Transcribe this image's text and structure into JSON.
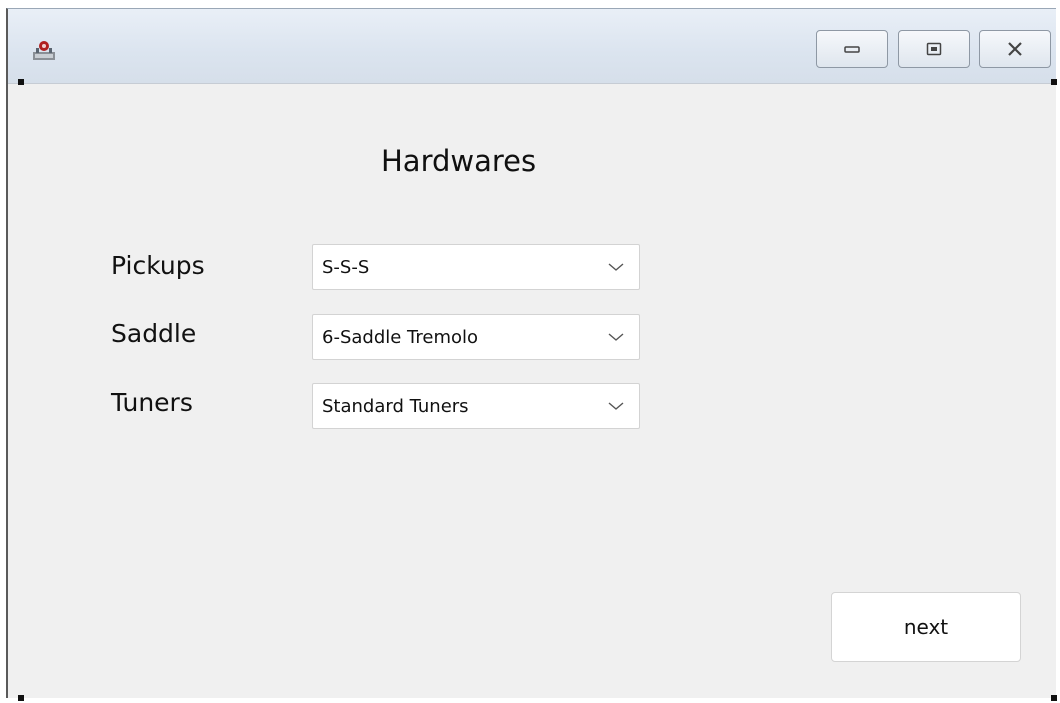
{
  "window": {
    "icon": "app-icon",
    "controls": {
      "minimize_icon": "minimize-icon",
      "maximize_icon": "maximize-icon",
      "close_icon": "close-icon"
    }
  },
  "form": {
    "title": "Hardwares",
    "fields": [
      {
        "label": "Pickups",
        "value": "S-S-S"
      },
      {
        "label": "Saddle",
        "value": "6-Saddle Tremolo"
      },
      {
        "label": "Tuners",
        "value": "Standard Tuners"
      }
    ],
    "next_label": "next"
  },
  "colors": {
    "panel_background": "#f0f0f0",
    "titlebar_background": "#dbe4ef",
    "input_background": "#ffffff",
    "border": "#d3d3d3"
  }
}
